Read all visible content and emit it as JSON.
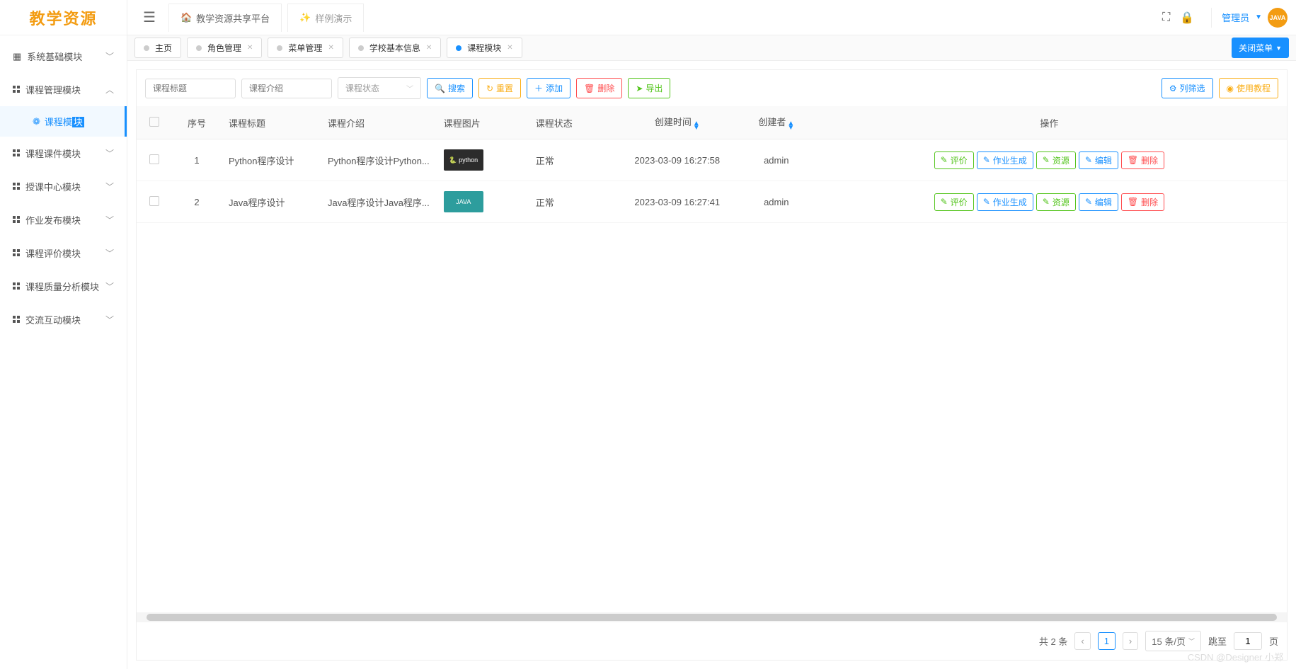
{
  "logo": "教学资源",
  "header": {
    "tab1": "教学资源共享平台",
    "tab2": "样例演示",
    "user": "管理员",
    "avatar_text": "JAVA"
  },
  "sidebar": {
    "items": [
      {
        "label": "系统基础模块",
        "expanded": false
      },
      {
        "label": "课程管理模块",
        "expanded": true
      },
      {
        "label": "课程课件模块",
        "expanded": false
      },
      {
        "label": "授课中心模块",
        "expanded": false
      },
      {
        "label": "作业发布模块",
        "expanded": false
      },
      {
        "label": "课程评价模块",
        "expanded": false
      },
      {
        "label": "课程质量分析模块",
        "expanded": false
      },
      {
        "label": "交流互动模块",
        "expanded": false
      }
    ],
    "sub_prefix": "课程模",
    "sub_suffix": "块"
  },
  "tabs": [
    {
      "label": "主页",
      "closable": false,
      "active": false
    },
    {
      "label": "角色管理",
      "closable": true,
      "active": false
    },
    {
      "label": "菜单管理",
      "closable": true,
      "active": false
    },
    {
      "label": "学校基本信息",
      "closable": true,
      "active": false
    },
    {
      "label": "课程模块",
      "closable": true,
      "active": true
    }
  ],
  "close_menu_btn": "关闭菜单",
  "toolbar": {
    "input1_placeholder": "课程标题",
    "input2_placeholder": "课程介绍",
    "select_placeholder": "课程状态",
    "search": "搜索",
    "reset": "重置",
    "add": "添加",
    "delete": "删除",
    "export": "导出",
    "columns": "列筛选",
    "tutorial": "使用教程"
  },
  "table": {
    "headers": {
      "seq": "序号",
      "title": "课程标题",
      "intro": "课程介绍",
      "image": "课程图片",
      "status": "课程状态",
      "created": "创建时间",
      "creator": "创建者",
      "actions": "操作"
    },
    "rows": [
      {
        "seq": "1",
        "title": "Python程序设计",
        "intro": "Python程序设计Python...",
        "img_label": "🐍 python",
        "img_class": "",
        "status": "正常",
        "created": "2023-03-09 16:27:58",
        "creator": "admin"
      },
      {
        "seq": "2",
        "title": "Java程序设计",
        "intro": "Java程序设计Java程序...",
        "img_label": "JAVA",
        "img_class": "teal",
        "status": "正常",
        "created": "2023-03-09 16:27:41",
        "creator": "admin"
      }
    ],
    "actions": {
      "evaluate": "评价",
      "homework": "作业生成",
      "resource": "资源",
      "edit": "编辑",
      "delete": "删除"
    }
  },
  "pagination": {
    "total": "共 2 条",
    "page": "1",
    "per_page": "15 条/页",
    "jump_label": "跳至",
    "jump_value": "1",
    "page_label": "页"
  },
  "watermark": "CSDN @Designer 小郑"
}
